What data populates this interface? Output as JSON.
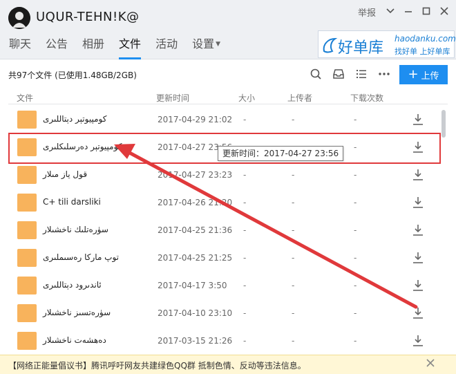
{
  "header": {
    "group_name": "UQUR-TEHN!K@",
    "report": "举报",
    "tabs": [
      {
        "label": "聊天"
      },
      {
        "label": "公告"
      },
      {
        "label": "相册"
      },
      {
        "label": "文件"
      },
      {
        "label": "活动"
      },
      {
        "label": "设置"
      }
    ],
    "active_tab": "文件",
    "ad": {
      "brand": "好单库",
      "url": "haodanku.com",
      "slogan": "找好单 上好单库"
    }
  },
  "toolbar": {
    "file_count": "共97个文件 (已使用1.48GB/2GB)",
    "upload_label": "上传"
  },
  "table": {
    "headers": {
      "file": "文件",
      "updated": "更新时间",
      "size": "大小",
      "uploader": "上传者",
      "downloads": "下载次数"
    },
    "rows": [
      {
        "name": "كومپيوتېر دېتاللىرى",
        "time": "2017-04-29 21:02",
        "size": "-",
        "uploader": "-",
        "downloads": "-"
      },
      {
        "name": "كومپيوتېر دەرسلىكلىرى",
        "time": "2017-04-27 23:56",
        "size": "-",
        "uploader": "-",
        "downloads": "-"
      },
      {
        "name": "قول ياز مىلار",
        "time": "2017-04-27 23:23",
        "size": "-",
        "uploader": "-",
        "downloads": "-"
      },
      {
        "name": "C+ tili darsliki",
        "time": "2017-04-26 21:20",
        "size": "-",
        "uploader": "-",
        "downloads": "-"
      },
      {
        "name": "سۈرەتلىك ناخشىلار",
        "time": "2017-04-25 21:36",
        "size": "-",
        "uploader": "-",
        "downloads": "-"
      },
      {
        "name": "توپ ماركا رەسىملىرى",
        "time": "2017-04-25 21:25",
        "size": "-",
        "uploader": "-",
        "downloads": "-"
      },
      {
        "name": "ئاندىرود دېتاللىرى",
        "time": "2017-04-17 3:50",
        "size": "-",
        "uploader": "-",
        "downloads": "-"
      },
      {
        "name": "سۈرەتسىز ناخشىلار",
        "time": "2017-04-10 23:10",
        "size": "-",
        "uploader": "-",
        "downloads": "-"
      },
      {
        "name": "دەھشەت ناخشىلار",
        "time": "2017-03-15 21:26",
        "size": "-",
        "uploader": "-",
        "downloads": "-"
      }
    ]
  },
  "tooltip": "更新时间：2017-04-27 23:56",
  "notice": {
    "title": "【网络正能量倡议书】",
    "text": "腾讯呼吁网友共建绿色QQ群 抵制色情、反动等违法信息。"
  },
  "colors": {
    "accent": "#1e8ef0",
    "folder": "#f8b35c",
    "highlight": "#e0393b",
    "notice_bg": "#fff7d6"
  }
}
